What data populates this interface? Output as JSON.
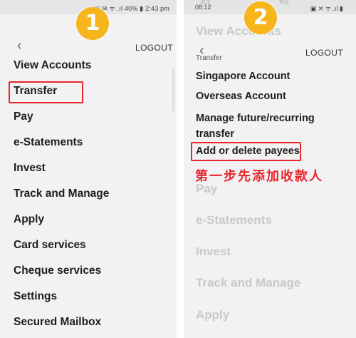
{
  "left_screen": {
    "status_bar": {
      "right_text": "☼ ▣ ✉ ᯤ .ıl 40% ▮ 2:43 pm"
    },
    "step_badge": "1",
    "logout_label": "LOGOUT",
    "menu": [
      "View Accounts",
      "Transfer",
      "Pay",
      "e-Statements",
      "Invest",
      "Track and Manage",
      "Apply",
      "Card services",
      "Cheque services",
      "Settings",
      "Secured Mailbox"
    ]
  },
  "right_screen": {
    "status_bar": {
      "time": "08:12",
      "right_text": "▣ ✕ ᯤ .ıl ▮",
      "faint_left": "共享",
      "faint_right": "转化"
    },
    "step_badge": "2",
    "logout_label": "LOGOUT",
    "faded_header": "View Accounts",
    "breadcrumb": "Transfer",
    "submenu": [
      "Singapore Account",
      "Overseas Account",
      "Manage future/recurring transfer",
      "Add or delete payees"
    ],
    "annotation": "第一步先添加收款人",
    "faded_menu": [
      "Pay",
      "e-Statements",
      "Invest",
      "Track and Manage",
      "Apply"
    ]
  },
  "colors": {
    "highlight": "#e8262d",
    "badge": "#f5b51b"
  }
}
